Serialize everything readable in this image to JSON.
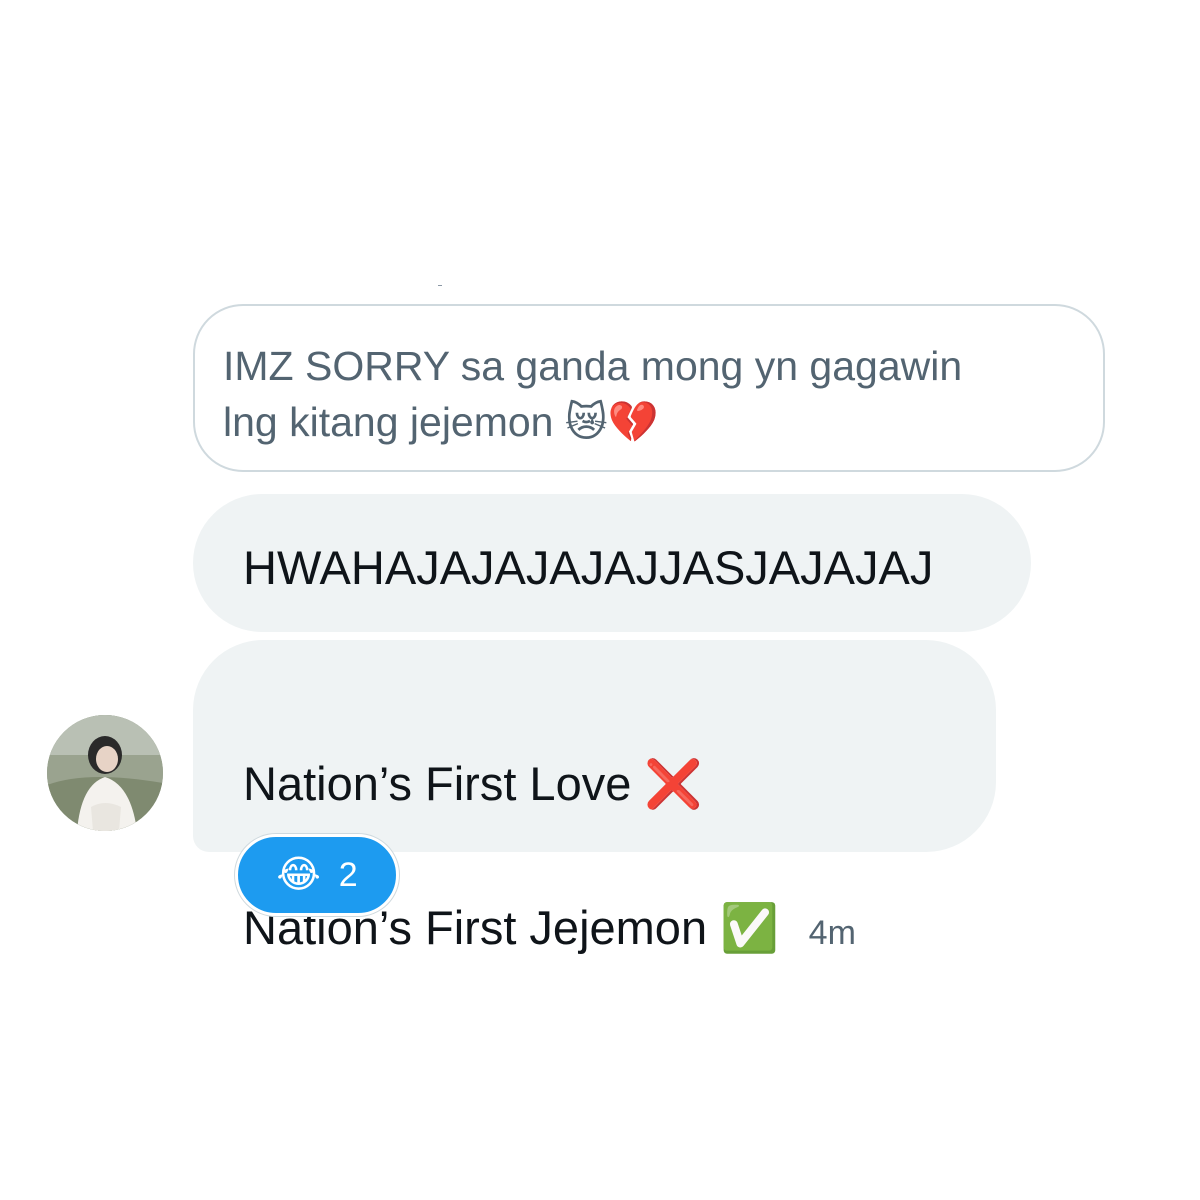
{
  "reply_quote": {
    "text": "IMZ SORRY sa ganda mong yn gagawin\nlng kitang jejemon 😿💔"
  },
  "messages": [
    {
      "text": "HWAHAJAJAJAJAJJASJAJAJAJ"
    },
    {
      "line1": "Nation’s First Love ❌",
      "line2": "Nation’s First Jejemon ✅",
      "timestamp": "4m"
    }
  ],
  "reaction": {
    "emoji": "😂",
    "count": "2"
  },
  "icons": {
    "avatar": "profile-photo"
  },
  "colors": {
    "bubble_bg": "#eff3f4",
    "quote_border": "#cfd9de",
    "reaction_bg": "#1d9bf0",
    "text_primary": "#0f1419",
    "text_secondary": "#536471"
  }
}
